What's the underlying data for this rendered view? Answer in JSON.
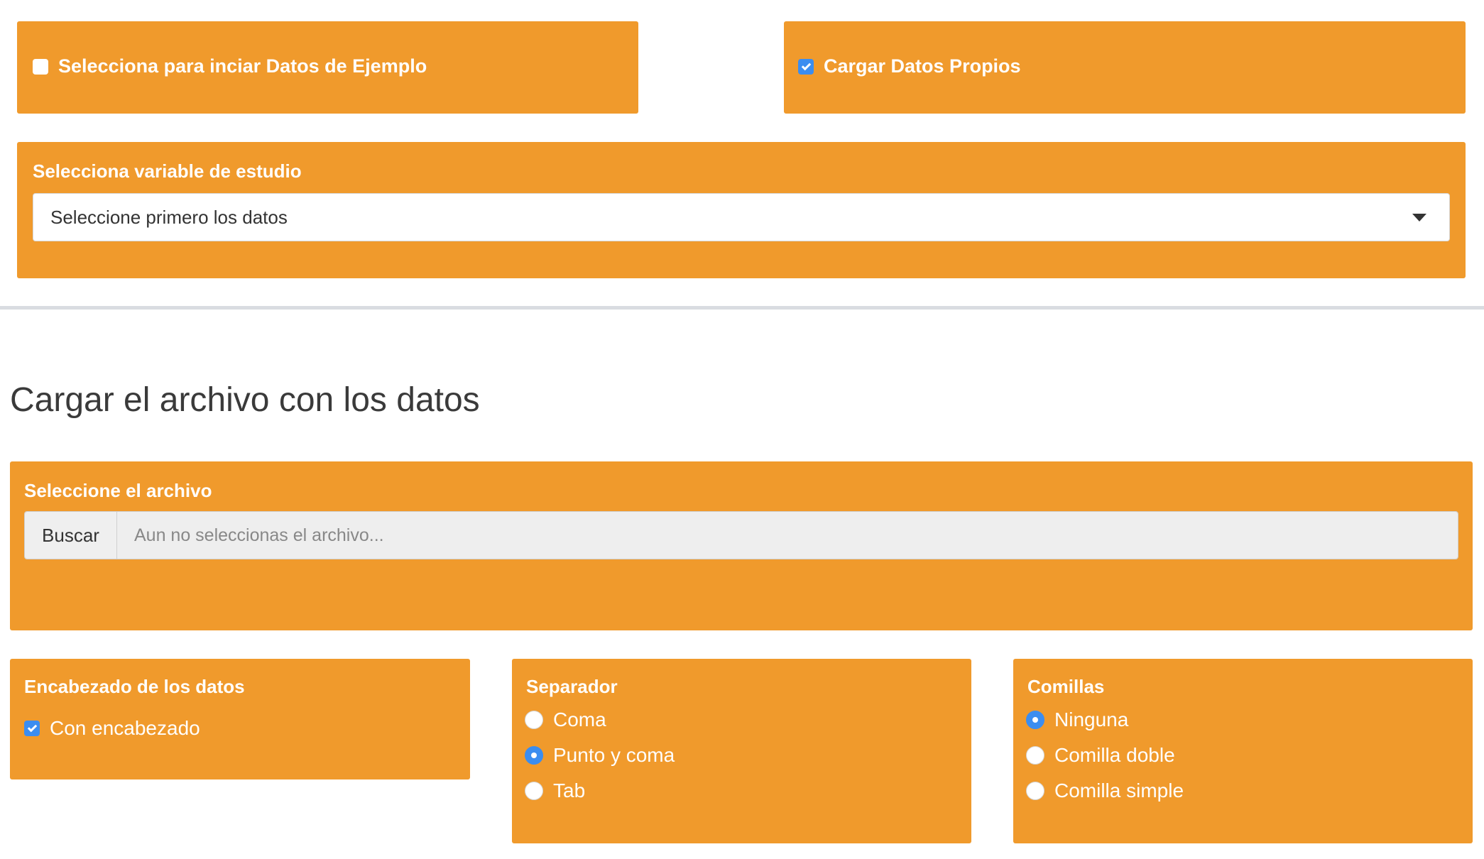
{
  "top": {
    "example_checkbox": {
      "label": "Selecciona para inciar Datos de Ejemplo",
      "checked": false
    },
    "own_data_checkbox": {
      "label": "Cargar Datos Propios",
      "checked": true
    }
  },
  "variable_select": {
    "heading": "Selecciona variable de estudio",
    "value": "Seleccione primero los datos"
  },
  "upload": {
    "section_title": "Cargar el archivo con los datos",
    "heading": "Seleccione el archivo",
    "browse_label": "Buscar",
    "file_placeholder": "Aun no seleccionas el archivo..."
  },
  "header_options": {
    "heading": "Encabezado de los datos",
    "checkbox_label": "Con encabezado",
    "checked": true
  },
  "separator": {
    "heading": "Separador",
    "options": [
      "Coma",
      "Punto y coma",
      "Tab"
    ],
    "selected": "Punto y coma"
  },
  "quotes": {
    "heading": "Comillas",
    "options": [
      "Ninguna",
      "Comilla doble",
      "Comilla simple"
    ],
    "selected": "Ninguna"
  },
  "colors": {
    "panel": "#f09a2c",
    "accent": "#3b8df0"
  }
}
